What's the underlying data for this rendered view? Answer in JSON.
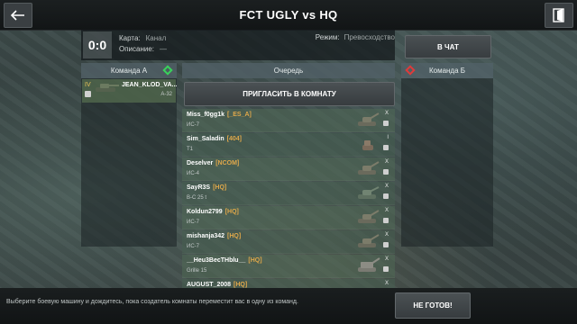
{
  "header": {
    "title": "FCT UGLY vs HQ"
  },
  "room": {
    "score": "0:0",
    "map_label": "Карта:",
    "map_value": "Канал",
    "description_label": "Описание:",
    "description_value": "—",
    "mode_label": "Режим:",
    "mode_value": "Превосходство"
  },
  "buttons": {
    "chat": "В ЧАТ",
    "invite": "ПРИГЛАСИТЬ В КОМНАТУ",
    "not_ready": "НЕ ГОТОВ!"
  },
  "team_a": {
    "label": "Команда А",
    "players": [
      {
        "tier": "IV",
        "name": "JEAN_KLOD_VA...",
        "tank": "A-32"
      }
    ]
  },
  "team_b": {
    "label": "Команда Б",
    "players": []
  },
  "queue": {
    "label": "Очередь",
    "players": [
      {
        "name": "Miss_f0gg1k",
        "clan": "[_ES_A]",
        "tank": "ИС-7",
        "tier": "X"
      },
      {
        "name": "Sim_Saladin",
        "clan": "[404]",
        "tank": "T1",
        "tier": "I"
      },
      {
        "name": "Deselver",
        "clan": "[NCOM]",
        "tank": "ИС-4",
        "tier": "X"
      },
      {
        "name": "SayR3S",
        "clan": "[HQ]",
        "tank": "B-C 25 t",
        "tier": "X"
      },
      {
        "name": "Koldun2799",
        "clan": "[HQ]",
        "tank": "ИС-7",
        "tier": "X"
      },
      {
        "name": "mishanja342",
        "clan": "[HQ]",
        "tank": "ИС-7",
        "tier": "X"
      },
      {
        "name": "__Heu3BecTHblu__",
        "clan": "[HQ]",
        "tank": "Grille 15",
        "tier": "X"
      },
      {
        "name": "AUGUST_2008",
        "clan": "[HQ]",
        "tank": "",
        "tier": "X"
      }
    ]
  },
  "footer": {
    "hint": "Выберите боевую машину и дождитесь, пока создатель комнаты переместит вас в одну из команд."
  },
  "icons": {
    "back": "arrow-left-icon",
    "exit": "exit-door-icon"
  }
}
